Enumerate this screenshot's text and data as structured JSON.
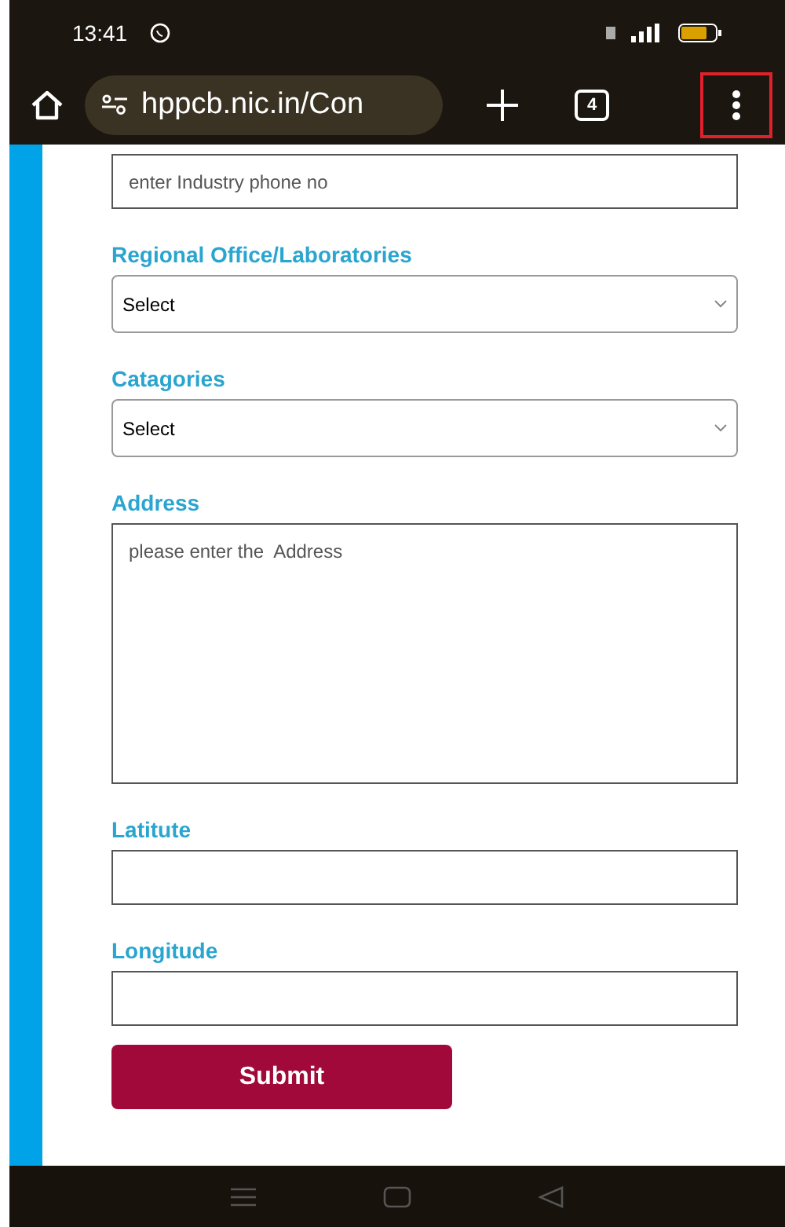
{
  "status_bar": {
    "time": "13:41"
  },
  "browser": {
    "url": "hppcb.nic.in/Con",
    "tab_count": "4",
    "menu_highlighted": true
  },
  "form": {
    "fields": [
      {
        "kind": "input",
        "placeholder": "enter Industry phone no"
      },
      {
        "kind": "select",
        "label": "Regional Office/Laboratories",
        "value": "Select"
      },
      {
        "kind": "select",
        "label": "Catagories",
        "value": "Select"
      },
      {
        "kind": "textarea",
        "label": "Address",
        "placeholder": "please enter the  Address"
      },
      {
        "kind": "input",
        "label": "Latitute"
      },
      {
        "kind": "input",
        "label": "Longitude"
      }
    ],
    "submit": "Submit"
  }
}
